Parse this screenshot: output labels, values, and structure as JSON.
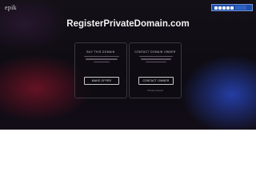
{
  "brand": {
    "logo_text": "epik"
  },
  "rating_badge": {
    "stars": 5,
    "caption": ""
  },
  "page": {
    "domain_title": "RegisterPrivateDomain.com"
  },
  "cards": [
    {
      "title": "BUY THIS DOMAIN",
      "button_label": "MAKE OFFER",
      "subtext": ""
    },
    {
      "title": "CONTACT DOMAIN OWNER",
      "button_label": "CONTACT OWNER",
      "subtext": "Privacy Guard"
    }
  ],
  "colors": {
    "accent_blue": "#1e4da8",
    "background": "#141018"
  }
}
